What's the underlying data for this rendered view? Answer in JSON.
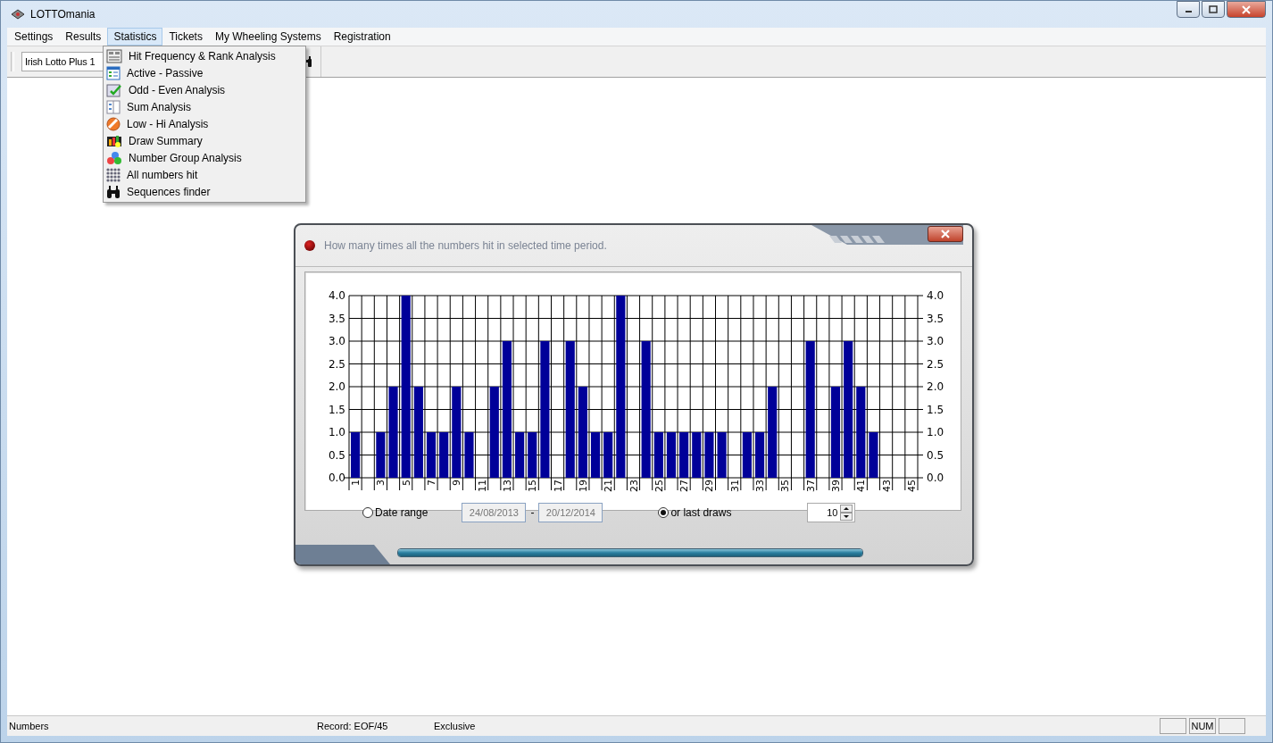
{
  "window": {
    "title": "LOTTOmania"
  },
  "menu_bar": [
    {
      "label": "Settings",
      "selected": false
    },
    {
      "label": "Results",
      "selected": false
    },
    {
      "label": "Statistics",
      "selected": true
    },
    {
      "label": "Tickets",
      "selected": false
    },
    {
      "label": "My Wheeling Systems",
      "selected": false
    },
    {
      "label": "Registration",
      "selected": false
    }
  ],
  "toolbar": {
    "lottery_select": "Irish Lotto Plus 1"
  },
  "dropdown_menu": {
    "items": [
      {
        "label": "Hit Frequency & Rank Analysis"
      },
      {
        "label": "Active - Passive"
      },
      {
        "label": "Odd - Even Analysis"
      },
      {
        "label": "Sum Analysis"
      },
      {
        "label": "Low - Hi Analysis"
      },
      {
        "label": "Draw Summary"
      },
      {
        "label": "Number Group Analysis"
      },
      {
        "label": "All numbers hit"
      },
      {
        "label": "Sequences finder"
      }
    ]
  },
  "dialog": {
    "title": "How many times all the numbers hit in selected time period.",
    "chart_data": {
      "type": "bar",
      "categories": [
        "1",
        null,
        "3",
        null,
        "5",
        null,
        "7",
        null,
        "9",
        null,
        "11",
        null,
        "13",
        null,
        "15",
        null,
        "17",
        null,
        "19",
        null,
        "21",
        null,
        "23",
        null,
        "25",
        null,
        "27",
        null,
        "29",
        null,
        "31",
        null,
        "33",
        null,
        "35",
        null,
        "37",
        null,
        "39",
        null,
        "41",
        null,
        "43",
        null,
        "45"
      ],
      "grid": true,
      "series": [
        {
          "color": "#000099",
          "values": [
            1,
            0,
            1,
            2,
            4,
            2,
            1,
            1,
            2,
            1,
            0,
            2,
            3,
            1,
            1,
            3,
            0,
            3,
            2,
            1,
            1,
            4,
            0,
            3,
            1,
            1,
            1,
            1,
            1,
            1,
            0,
            1,
            1,
            2,
            0,
            0,
            3,
            0,
            2,
            3,
            2,
            1,
            0,
            0,
            0
          ]
        }
      ],
      "ylim": [
        0,
        4
      ],
      "yticks": [
        {
          "value": 0,
          "label": "0.0"
        },
        {
          "value": 0.5,
          "label": "0.5"
        },
        {
          "value": 1,
          "label": "1.0"
        },
        {
          "value": 1.5,
          "label": "1.5"
        },
        {
          "value": 2,
          "label": "2.0"
        },
        {
          "value": 2.5,
          "label": "2.5"
        },
        {
          "value": 3,
          "label": "3.0"
        },
        {
          "value": 3.5,
          "label": "3.5"
        },
        {
          "value": 4,
          "label": "4.0"
        }
      ]
    },
    "date_range": {
      "label": "Date range",
      "selected": false,
      "from": "24/08/2013",
      "separator": "-",
      "to": "20/12/2014"
    },
    "last_draws": {
      "label": "or last draws",
      "selected": true,
      "value": "10"
    },
    "progress": {
      "level": 1
    }
  },
  "status_bar": {
    "panels": [
      "Numbers",
      "Record: EOF/45",
      "Exclusive"
    ],
    "num_indicator": "NUM"
  }
}
